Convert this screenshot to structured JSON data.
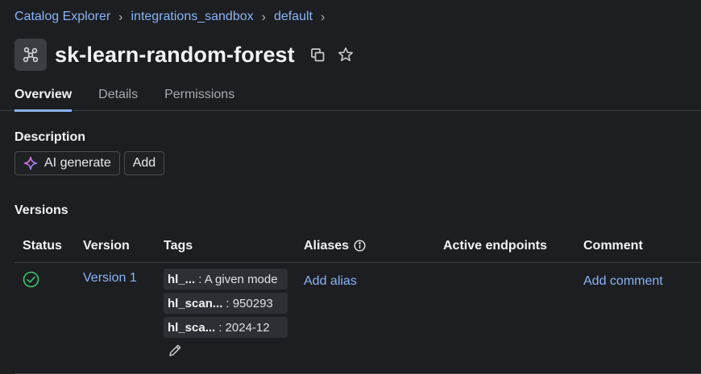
{
  "breadcrumb": [
    {
      "label": "Catalog Explorer"
    },
    {
      "label": "integrations_sandbox"
    },
    {
      "label": "default"
    }
  ],
  "title": "sk-learn-random-forest",
  "tabs": [
    {
      "label": "Overview",
      "active": true
    },
    {
      "label": "Details",
      "active": false
    },
    {
      "label": "Permissions",
      "active": false
    }
  ],
  "description": {
    "label": "Description",
    "ai_generate_label": "AI generate",
    "add_label": "Add"
  },
  "versions": {
    "label": "Versions",
    "columns": [
      "Status",
      "Version",
      "Tags",
      "Aliases",
      "Active endpoints",
      "Comment"
    ],
    "rows": [
      {
        "status": "ready",
        "version": "Version 1",
        "tags": [
          {
            "key": "hl_...",
            "value": ": A given mode"
          },
          {
            "key": "hl_scan...",
            "value": ": 950293"
          },
          {
            "key": "hl_sca...",
            "value": ": 2024-12"
          }
        ],
        "add_alias": "Add alias",
        "active_endpoints": "",
        "add_comment": "Add comment"
      }
    ]
  },
  "colors": {
    "background": "#1c1e21",
    "link": "#8ab4f8",
    "status_ok": "#3ec46d",
    "border": "#3c3f44"
  },
  "icons": {
    "model": "model-graph-icon",
    "copy": "copy-icon",
    "favorite": "star-icon",
    "ai": "sparkle-icon",
    "info": "info-icon",
    "status": "check-circle-icon",
    "edit": "pencil-icon"
  }
}
